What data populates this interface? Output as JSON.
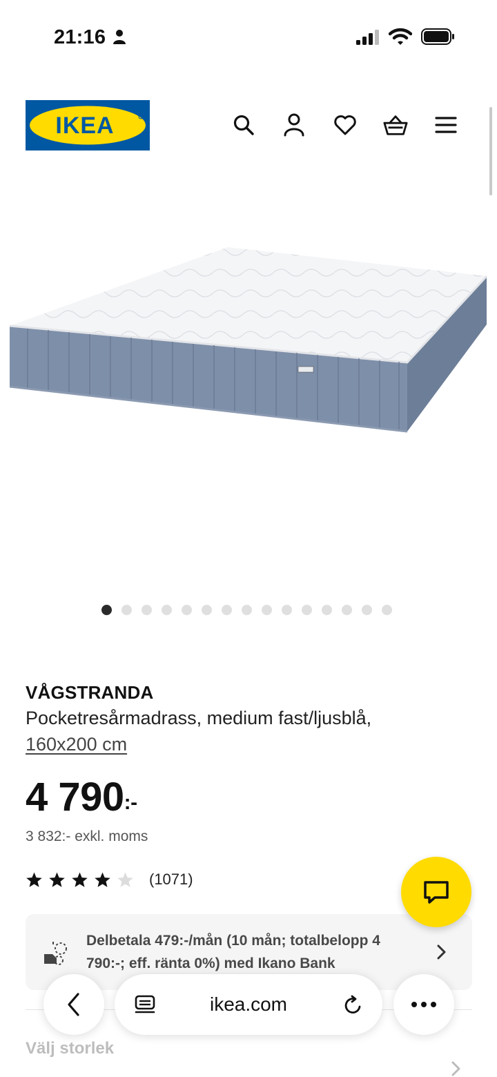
{
  "status_bar": {
    "time": "21:16"
  },
  "header": {
    "logo_text": "IKEA",
    "icons": [
      "search-icon",
      "account-icon",
      "heart-icon",
      "cart-icon",
      "menu-icon"
    ]
  },
  "carousel": {
    "dot_count": 15,
    "active_index": 0
  },
  "product": {
    "name": "VÅGSTRANDA",
    "description": "Pocketresårmadrass, medium fast/ljusblå,",
    "size": "160x200 cm",
    "price": "4 790",
    "price_suffix": ":-",
    "price_exkl": "3 832:- exkl. moms",
    "rating_stars": 4,
    "rating_max": 5,
    "rating_count": "(1071)"
  },
  "financing": {
    "text": "Delbetala 479:-/mån (10 mån; totalbelopp 4 790:-; eff. ränta 0%) med Ikano Bank"
  },
  "choose_size": {
    "label": "Välj storlek"
  },
  "browser": {
    "url": "ikea.com"
  },
  "colors": {
    "ikea_blue": "#0058a3",
    "ikea_yellow": "#ffdb00",
    "mattress_side": "#7d8ea8"
  }
}
